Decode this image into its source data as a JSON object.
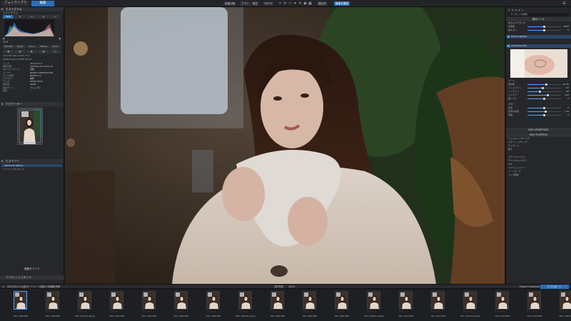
{
  "tabs": {
    "library": "フォトライブラリ",
    "edit": "編集"
  },
  "toolbar": {
    "btn_a": "画像比較",
    "btn_b": "ブラシ",
    "btn_c": "補正",
    "zoom": "100 %",
    "btn_d": "補正前",
    "btn_e": "編集を確認",
    "icons": [
      "crop-icon",
      "rotate-icon",
      "straighten-icon",
      "wand-icon",
      "brush-icon",
      "eye-icon",
      "grid-icon"
    ]
  },
  "left": {
    "histogram_head": "ヒストグラム",
    "histogram_sub": "ヒストグラム",
    "histo_modes": [
      "RGB",
      "R",
      "G",
      "B",
      "L"
    ],
    "exif_btns": [
      "ISO 200",
      "1/125",
      "f/1.4",
      "35mm",
      "EV 0"
    ],
    "info": [
      {
        "k": "レンズ",
        "v": "35mm F1.4"
      },
      {
        "k": "撮影日時",
        "v": "2023/01/15 14:20:32"
      },
      {
        "k": "ホワイトバランス",
        "v": "自動"
      },
      {
        "k": "メーカー",
        "v": "NIKON CORPORATION"
      },
      {
        "k": "カメラ名称",
        "v": "NIKON Z 6"
      },
      {
        "k": "ピクチャー",
        "v": "標準"
      },
      {
        "k": "サイズ",
        "v": "6048×4024"
      },
      {
        "k": "色空間",
        "v": "sRGB"
      },
      {
        "k": "露出モード",
        "v": "マニュアル"
      },
      {
        "k": "測光",
        "v": "—"
      }
    ],
    "small_lines": [
      "28.0 ISO 400 1/125s F1.4",
      "6048×4024 24.3MP 35mm"
    ],
    "navigator_head": "ナビゲーター",
    "history_head": "ヒストリー",
    "history_item_1": "Advanced History",
    "history_item_2": "ヒストリーのリセット",
    "bottom_1": "履歴をクリア",
    "bottom_2": "プリセットとスタイル"
  },
  "right": {
    "search_placeholder": "プリセットの検索",
    "basic_head": "基本ツール",
    "wb_head": "ホワイトバランス",
    "wb_rows": [
      {
        "label": "色温度",
        "value": "5500",
        "pos": 0.5
      },
      {
        "label": "色かぶり",
        "value": "0",
        "pos": 0.5
      }
    ],
    "bar_1": "Smart Lighting",
    "bar_2": "ClearView Plus",
    "tone_head": "トーン",
    "tone_rows": [
      {
        "label": "露光量",
        "value": "+0.30",
        "pos": 0.56
      },
      {
        "label": "コントラスト",
        "value": "-10",
        "pos": 0.45
      },
      {
        "label": "ハイライト",
        "value": "-25",
        "pos": 0.38
      },
      {
        "label": "シャドウ",
        "value": "+20",
        "pos": 0.6
      },
      {
        "label": "黒レベル",
        "value": "0",
        "pos": 0.5
      }
    ],
    "color_head": "カラー",
    "color_rows": [
      {
        "label": "彩度",
        "value": "0",
        "pos": 0.5
      },
      {
        "label": "自然な彩度",
        "value": "+10",
        "pos": 0.55
      },
      {
        "label": "色相",
        "value": "0",
        "pos": 0.5
      }
    ],
    "viewpoint_head": "DXO VIEWPOINT",
    "filmpack_head": "DXO FILMPACK",
    "filmpack_rows": [
      "フィルムレンダリング",
      "カラーレンダリング",
      "ヴィネット",
      "粒子"
    ],
    "lower_rows": [
      "カラーマトリクス",
      "チャンネルミキサー",
      "HSL",
      "スプリットトーン",
      "トーンカーブ",
      "ノイズ除去"
    ]
  },
  "filmstrip": {
    "path": "2023/01/15 女性ポートレート撮影/人物撮影作例",
    "count": "選択枚数",
    "count_value": "1/272",
    "collection": "Project Collection",
    "export": "エクスポート",
    "items": [
      "DSC_2046.NEF",
      "DSC_2048.NEF",
      "DSC_2050-R_99.jpg",
      "DSC_2052.NEF",
      "DSC_2054.NEF",
      "DSC_2056.NEF",
      "DSC_2058.NEF",
      "DSC_2060-R_99.jpg",
      "DSC_2062.NEF",
      "DSC_2064.NEF",
      "DSC_2066.NEF",
      "DSC_2068-R_99.jpg",
      "DSC_2070.NEF",
      "DSC_2072.NEF",
      "DSC_2074-R_99.jpg",
      "DSC_2076.NEF",
      "DSC_2078.NEF",
      "DSC_2080.NEF"
    ]
  }
}
